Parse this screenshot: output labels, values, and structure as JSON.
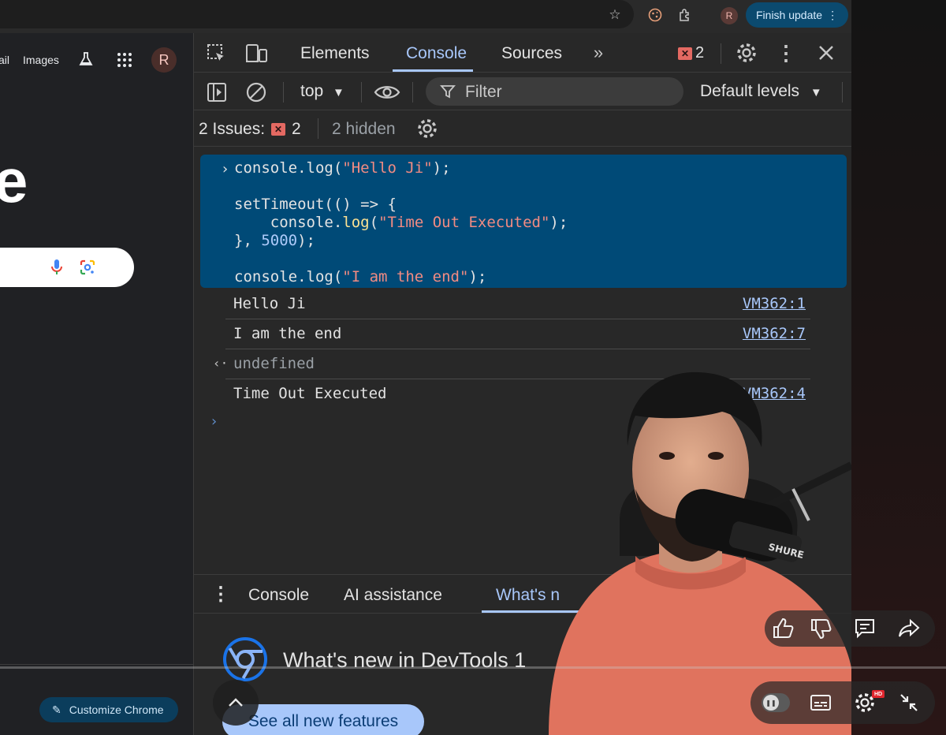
{
  "browser": {
    "finish_update_label": "Finish update",
    "profile_initial": "R"
  },
  "google": {
    "mail_label": "ail",
    "images_label": "Images",
    "avatar_initial": "R",
    "logo_fragment": "e",
    "customize_label": "Customize Chrome"
  },
  "devtools": {
    "tabs": {
      "elements": "Elements",
      "console": "Console",
      "sources": "Sources"
    },
    "error_count": "2",
    "toolbar": {
      "context": "top",
      "filter_placeholder": "Filter",
      "levels": "Default levels"
    },
    "issues": {
      "label": "2 Issues:",
      "count": "2",
      "hidden": "2 hidden"
    },
    "input_lines": {
      "l1_fn": "console.log(",
      "l1_str": "\"Hello Ji\"",
      "l1_end": ");",
      "l3": "setTimeout(() => {",
      "l4_pre": "    console.",
      "l4_fn": "log",
      "l4_open": "(",
      "l4_str": "\"Time Out Executed\"",
      "l4_end": ");",
      "l5_pre": "}, ",
      "l5_num": "5000",
      "l5_end": ");",
      "l7_fn": "console.log(",
      "l7_str": "\"I am the end\"",
      "l7_end": ");"
    },
    "logs": [
      {
        "message": "Hello Ji",
        "source": "VM362:1"
      },
      {
        "message": "I am the end",
        "source": "VM362:7"
      },
      {
        "message": "undefined",
        "source": ""
      },
      {
        "message": "Time Out Executed",
        "source": "VM362:4"
      }
    ],
    "drawer": {
      "tab_console": "Console",
      "tab_ai": "AI assistance",
      "tab_whats": "What's n",
      "whats_title": "What's new in DevTools 1",
      "see_all_label": "See all new features"
    }
  },
  "video_overlay": {
    "hd_badge": "HD",
    "mic_brand": "SHURE"
  },
  "colors": {
    "accent": "#a8c7fa",
    "selection": "#004a77",
    "error": "#e46962",
    "update_button": "#0b4a6f"
  }
}
